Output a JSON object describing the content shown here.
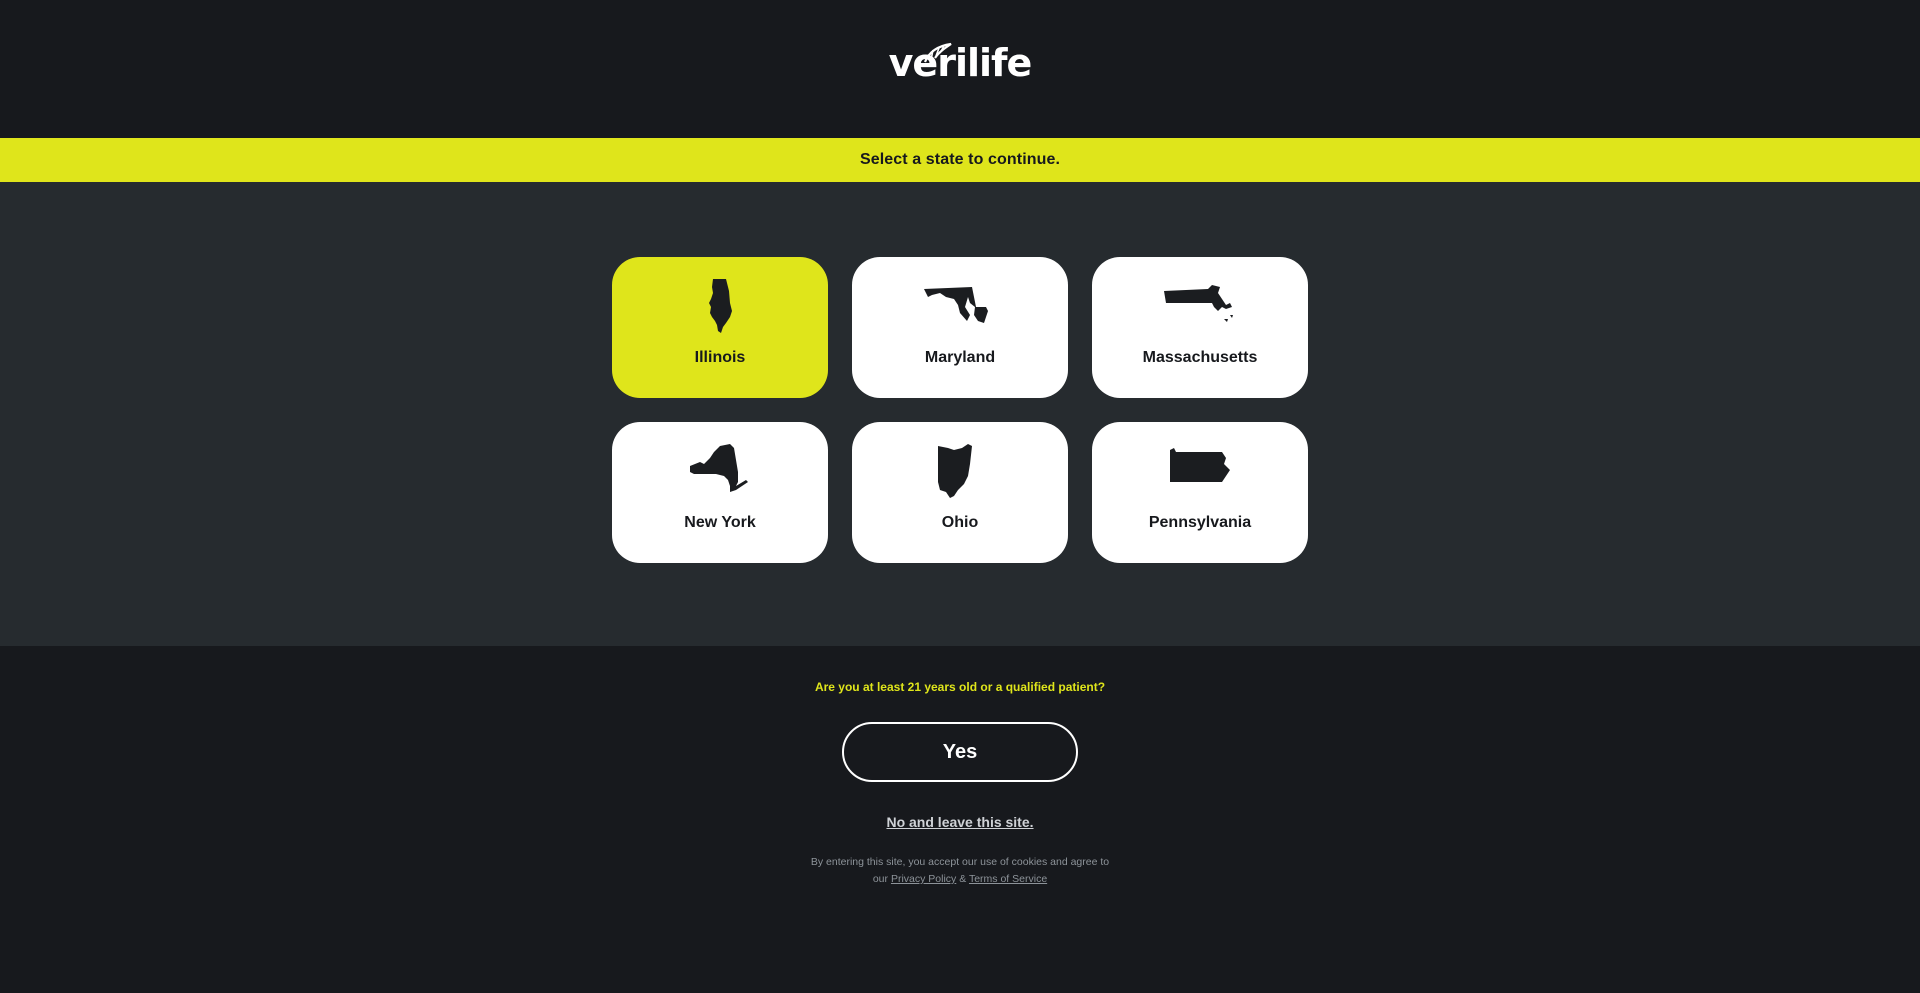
{
  "header": {
    "logo_text": "verilife"
  },
  "banner": {
    "text": "Select a state to continue."
  },
  "states": [
    {
      "label": "Illinois",
      "icon": "illinois-map-icon",
      "selected": true
    },
    {
      "label": "Maryland",
      "icon": "maryland-map-icon",
      "selected": false
    },
    {
      "label": "Massachusetts",
      "icon": "massachusetts-map-icon",
      "selected": false
    },
    {
      "label": "New York",
      "icon": "new-york-map-icon",
      "selected": false
    },
    {
      "label": "Ohio",
      "icon": "ohio-map-icon",
      "selected": false
    },
    {
      "label": "Pennsylvania",
      "icon": "pennsylvania-map-icon",
      "selected": false
    }
  ],
  "age_gate": {
    "question": "Are you at least 21 years old or a qualified patient?",
    "yes_label": "Yes",
    "no_label": "No and leave this site.",
    "legal_line1": "By entering this site, you accept our use of cookies and agree to",
    "legal_prefix": "our",
    "privacy_label": "Privacy Policy",
    "amp": "&",
    "terms_label": "Terms of Service"
  },
  "colors": {
    "accent": "#dfe51b",
    "background_dark": "#17191d",
    "background_mid": "#262b2f",
    "card": "#ffffff"
  }
}
